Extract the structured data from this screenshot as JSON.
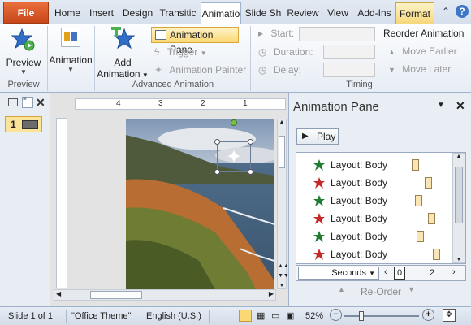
{
  "tabs": {
    "file": "File",
    "items": [
      "Home",
      "Insert",
      "Design",
      "Transitic",
      "Animatio",
      "Slide Sh",
      "Review",
      "View",
      "Add-Ins",
      "Format"
    ],
    "active_index": 4
  },
  "ribbon": {
    "preview": {
      "label": "Preview",
      "group": "Preview"
    },
    "animation": {
      "label": "Animation"
    },
    "add_animation": {
      "label_line1": "Add",
      "label_line2": "Animation"
    },
    "advanced": {
      "group": "Advanced Animation",
      "animation_pane": "Animation Pane",
      "trigger": "Trigger",
      "painter": "Animation Painter"
    },
    "timing": {
      "group": "Timing",
      "start": "Start:",
      "duration": "Duration:",
      "delay": "Delay:",
      "reorder": "Reorder Animation",
      "move_earlier": "Move Earlier",
      "move_later": "Move Later"
    }
  },
  "slides": [
    {
      "number": "1"
    }
  ],
  "ruler_marks": [
    "4",
    "3",
    "2",
    "1"
  ],
  "animation_pane": {
    "title": "Animation Pane",
    "play": "Play",
    "items": [
      {
        "label": "Layout: Body",
        "color": "#1e7d32"
      },
      {
        "label": "Layout: Body",
        "color": "#c62828"
      },
      {
        "label": "Layout: Body",
        "color": "#1e7d32"
      },
      {
        "label": "Layout: Body",
        "color": "#c62828"
      },
      {
        "label": "Layout: Body",
        "color": "#1e7d32"
      },
      {
        "label": "Layout: Body",
        "color": "#c62828"
      }
    ],
    "seconds": "Seconds",
    "timeline_start": "0",
    "timeline_end": "2",
    "reorder": "Re-Order"
  },
  "status": {
    "slide": "Slide 1 of 1",
    "theme": "\"Office Theme\"",
    "language": "English (U.S.)",
    "zoom": "52%",
    "zoom_level": 0.52
  }
}
